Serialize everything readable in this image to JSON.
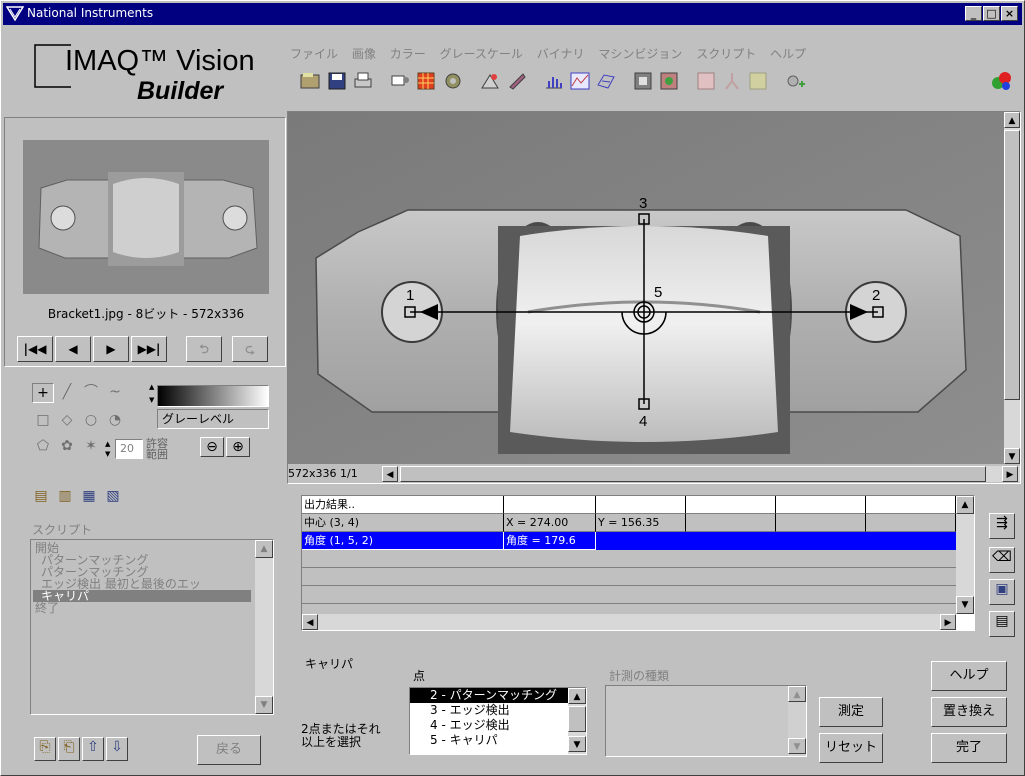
{
  "window": {
    "title": "National Instruments"
  },
  "logo": {
    "line1": "IMAQ™ Vision",
    "line2": "Builder"
  },
  "menu": [
    "ファイル",
    "画像",
    "カラー",
    "グレースケール",
    "バイナリ",
    "マシンビジョン",
    "スクリプト",
    "ヘルプ"
  ],
  "thumbnail": {
    "caption": "Bracket1.jpg - 8ビット - 572x336"
  },
  "tools": {
    "gray_label": "グレーレベル",
    "tolerance_value": "20",
    "tolerance_label_1": "許容",
    "tolerance_label_2": "範囲"
  },
  "script": {
    "label": "スクリプト",
    "items": [
      "開始",
      "パターンマッチング",
      "パターンマッチング",
      "エッジ検出 最初と最後のエッ",
      "キャリパ",
      "終了"
    ],
    "back_label": "戻る"
  },
  "image": {
    "status": "572x336 1/1",
    "markers": {
      "p1": "1",
      "p2": "2",
      "p3": "3",
      "p4": "4",
      "p5": "5"
    }
  },
  "results": {
    "header": "出力結果..",
    "rows": [
      {
        "name": "中心 (3, 4)",
        "v1": "X = 274.00",
        "v2": "Y = 156.35"
      },
      {
        "name": "角度 (1, 5, 2)",
        "v1": "角度 = 179.6",
        "v2": ""
      }
    ]
  },
  "caliper": {
    "title": "キャリパ",
    "points_label": "点",
    "points": [
      "2 - パターンマッチング",
      "3 - エッジ検出",
      "4 - エッジ検出",
      "5 - キャリパ"
    ],
    "instruction_1": "2点またはそれ",
    "instruction_2": "以上を選択",
    "measure_type_label": "計測の種類",
    "measure_button": "測定",
    "reset_button": "リセット",
    "help_button": "ヘルプ",
    "replace_button": "置き換え",
    "done_button": "完了"
  },
  "colors": {
    "titlebar": "#000080",
    "selection": "#0000ff",
    "face": "#c0c0c0"
  }
}
